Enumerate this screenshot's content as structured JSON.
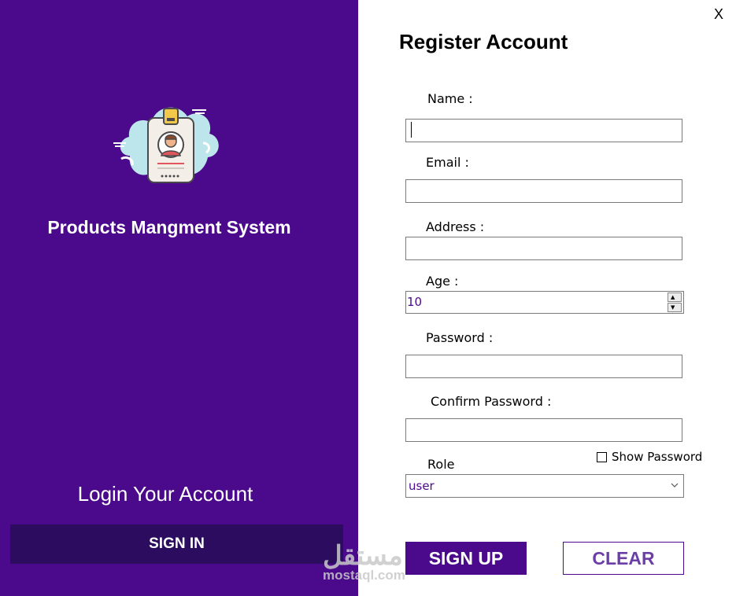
{
  "left_panel": {
    "logo_icon": "id-badge-icon",
    "system_title": "Products Mangment System",
    "login_title": "Login Your Account",
    "sign_in_label": "SIGN IN"
  },
  "window": {
    "close_label": "X"
  },
  "form": {
    "title": "Register Account",
    "name_label": "Name :",
    "name_value": "",
    "email_label": "Email :",
    "email_value": "",
    "address_label": "Address :",
    "address_value": "",
    "age_label": "Age :",
    "age_value": "10",
    "password_label": "Password :",
    "password_value": "",
    "confirm_password_label": "Confirm Password :",
    "confirm_password_value": "",
    "show_password_label": "Show Password",
    "show_password_checked": false,
    "role_label": "Role",
    "role_value": "user",
    "signup_label": "SIGN UP",
    "clear_label": "CLEAR"
  },
  "watermark": {
    "arabic": "مستقل",
    "latin": "mostaql.com"
  },
  "colors": {
    "brand_purple": "#4b0a8c",
    "sign_in_bg": "#2b0c5e",
    "clear_text": "#6b3fa6"
  }
}
